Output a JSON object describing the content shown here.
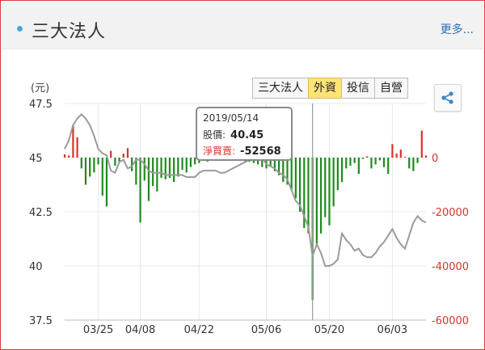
{
  "header": {
    "title": "三大法人",
    "more_label": "更多..."
  },
  "tabs": [
    {
      "label": "三大法人",
      "active": false
    },
    {
      "label": "外資",
      "active": true
    },
    {
      "label": "投信",
      "active": false
    },
    {
      "label": "自營",
      "active": false
    }
  ],
  "share_icon": "share-icon",
  "tooltip": {
    "date": "2019/05/14",
    "price_label": "股價:",
    "price_value": "40.45",
    "net_label": "淨買賣:",
    "net_value": "-52568"
  },
  "colors": {
    "buy": "#d9332b",
    "sell": "#1e8a1e",
    "price_line": "#9a9a9a",
    "accent_tab": "#ffe37a"
  },
  "chart_data": {
    "type": "bar",
    "left_axis": {
      "label": "(元)",
      "ticks": [
        "47.5",
        "45",
        "42.5",
        "40",
        "37.5"
      ],
      "range": [
        37.5,
        47.5
      ]
    },
    "right_axis": {
      "ticks": [
        "0",
        "-20000",
        "-40000",
        "-60000"
      ],
      "range": [
        -60000,
        20000
      ]
    },
    "x_ticks": [
      "03/25",
      "04/08",
      "04/22",
      "05/06",
      "05/20",
      "06/03"
    ],
    "x_tick_index": [
      8,
      18,
      32,
      48,
      63,
      78
    ],
    "series": [
      {
        "type": "bar",
        "values": [
          1200,
          800,
          12000,
          7500,
          -4000,
          -10000,
          -7000,
          -5500,
          -2500,
          -14000,
          -18000,
          2500,
          -3000,
          -1500,
          1500,
          3500,
          -5000,
          -10000,
          -24000,
          -8500,
          -16000,
          -10500,
          -12500,
          -7500,
          -8000,
          -7500,
          -9000,
          -7000,
          -4500,
          -5500,
          -3500,
          -2500,
          -2000,
          -1200,
          -1500,
          -1000,
          -900,
          -800,
          -600,
          -500,
          -400,
          -300,
          -900,
          -1500,
          -1500,
          -2000,
          -2500,
          -3500,
          -4000,
          -3500,
          -5000,
          -6500,
          -9000,
          -10000,
          -12000,
          -15000,
          -20000,
          -26000,
          -28000,
          -52568,
          -32000,
          -28000,
          -22000,
          -25000,
          -18000,
          -12000,
          -9000,
          -4000,
          -3000,
          -2000,
          -6000,
          -500,
          500,
          -4000,
          -2500,
          -1000,
          -3500,
          -6000,
          5000,
          1500,
          3000,
          300,
          -4000,
          -5000,
          -2000,
          10000,
          800
        ],
        "colors_by_sign": true
      },
      {
        "type": "line",
        "values": [
          45.4,
          45.8,
          46.5,
          46.8,
          47.0,
          46.8,
          46.5,
          46.0,
          45.4,
          45.2,
          45.1,
          44.4,
          44.3,
          44.8,
          44.9,
          44.5,
          44.6,
          44.9,
          44.9,
          44.7,
          44.4,
          44.3,
          44.3,
          44.3,
          44.2,
          44.2,
          44.2,
          44.2,
          44.2,
          44.1,
          44.1,
          44.1,
          44.3,
          44.4,
          44.4,
          44.4,
          44.4,
          44.3,
          44.3,
          44.4,
          44.5,
          44.6,
          44.7,
          44.8,
          44.9,
          44.9,
          45.0,
          45.0,
          44.7,
          44.6,
          44.5,
          44.3,
          44.2,
          44.0,
          43.5,
          43.0,
          42.8,
          42.3,
          41.8,
          40.45,
          41.0,
          40.6,
          40.0,
          40.0,
          40.1,
          40.3,
          41.5,
          41.2,
          41.0,
          40.7,
          40.8,
          40.5,
          40.4,
          40.4,
          40.6,
          40.9,
          41.1,
          41.4,
          41.7,
          41.3,
          41.0,
          40.8,
          41.4,
          42.0,
          42.3,
          42.1,
          42.0
        ]
      }
    ],
    "highlight_index": 59
  }
}
